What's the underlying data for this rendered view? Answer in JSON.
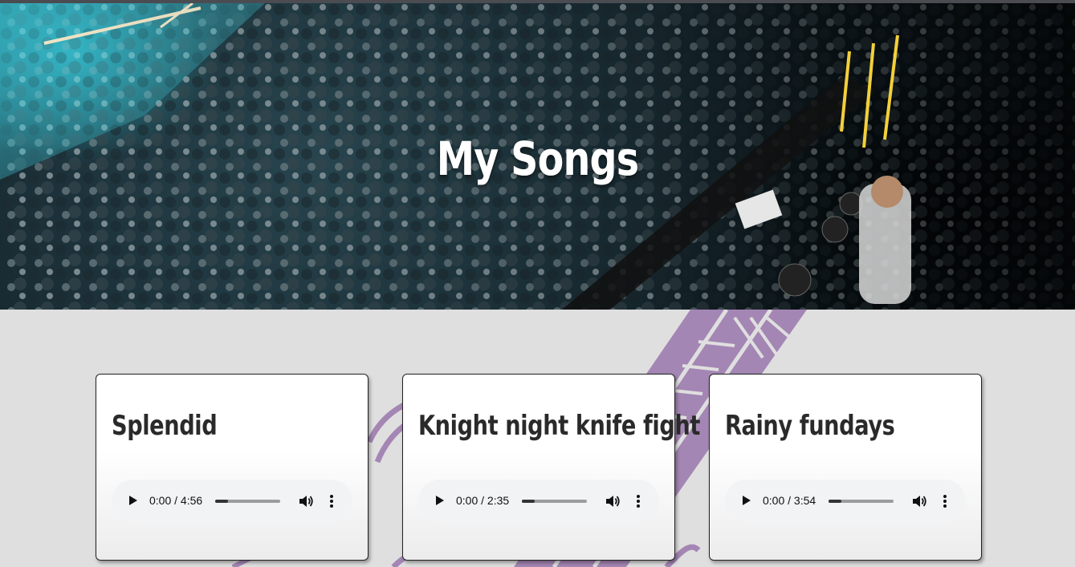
{
  "page": {
    "title": "My Songs"
  },
  "songs": [
    {
      "title": "Splendid",
      "current_time": "0:00",
      "duration": "4:56",
      "progress": 0.03
    },
    {
      "title": "Knight night knife fight",
      "current_time": "0:00",
      "duration": "2:35",
      "progress": 0.03
    },
    {
      "title": "Rainy fundays",
      "current_time": "0:00",
      "duration": "3:54",
      "progress": 0.03
    }
  ],
  "colors": {
    "background": "#dfdfdf",
    "decoration": "#a486b4",
    "card_border": "#222222",
    "hero_accent": "#30c4d6"
  },
  "icons": {
    "play": "play-icon",
    "volume": "volume-icon",
    "more": "more-vertical-icon"
  }
}
